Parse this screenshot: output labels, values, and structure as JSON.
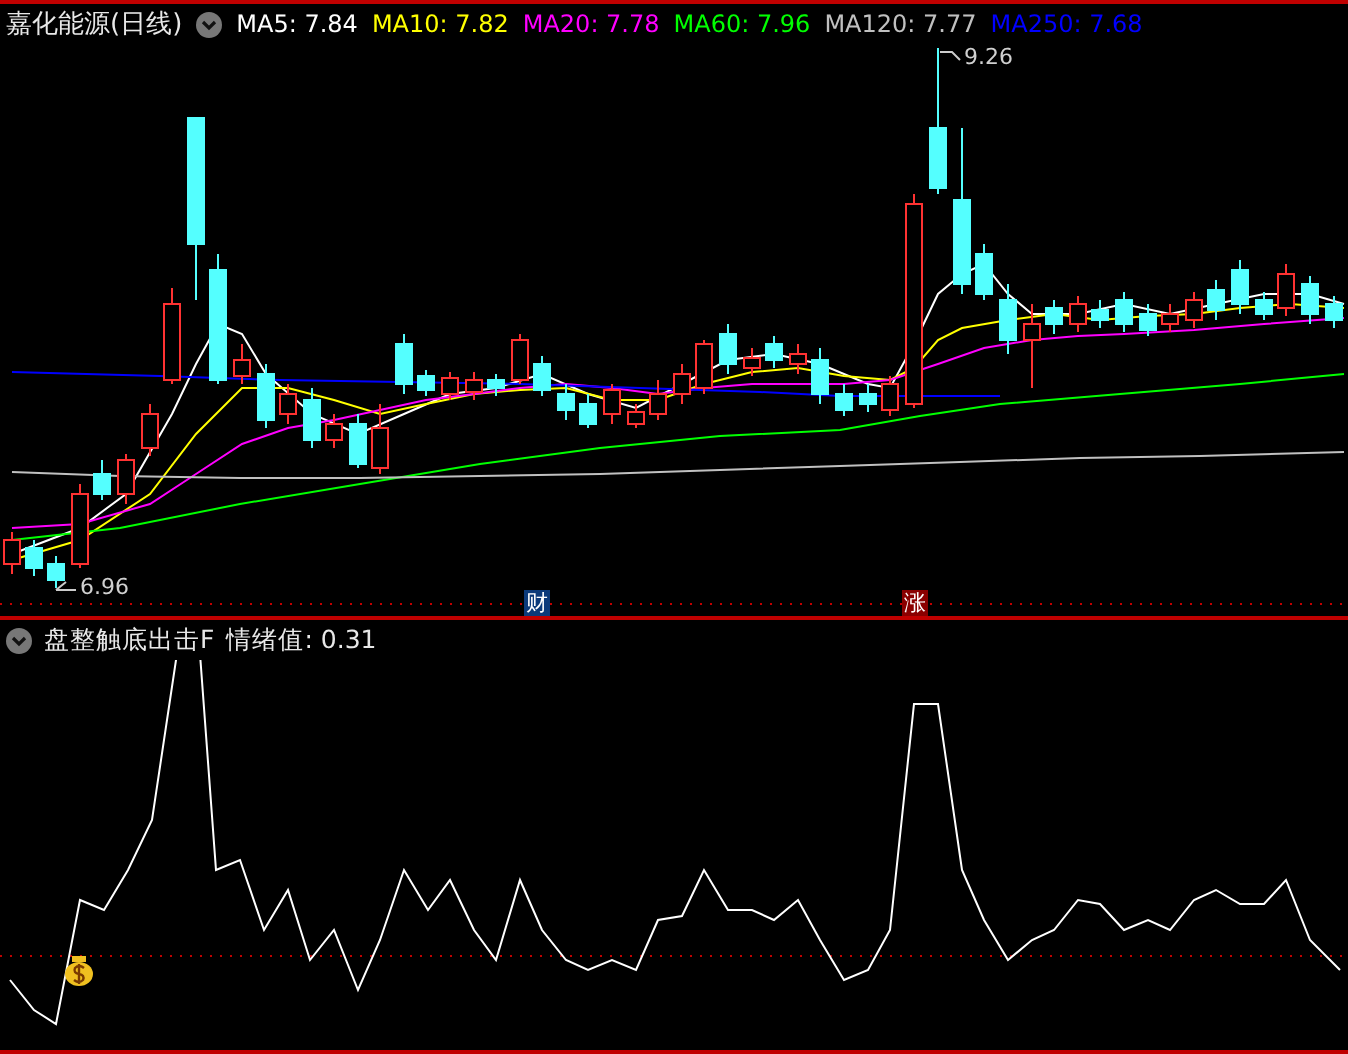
{
  "title": "嘉化能源(日线)",
  "moving_averages": [
    {
      "label": "MA5: 7.84",
      "color": "#ffffff"
    },
    {
      "label": "MA10: 7.82",
      "color": "#ffff00"
    },
    {
      "label": "MA20: 7.78",
      "color": "#ff00ff"
    },
    {
      "label": "MA60: 7.96",
      "color": "#00ff00"
    },
    {
      "label": "MA120: 7.77",
      "color": "#c0c0c0"
    },
    {
      "label": "MA250: 7.68",
      "color": "#0000ff"
    }
  ],
  "price_panel": {
    "high_label": "9.26",
    "low_label": "6.96",
    "markers": [
      {
        "text": "财",
        "kind": "finance"
      },
      {
        "text": "涨",
        "kind": "rise"
      }
    ]
  },
  "indicator": {
    "name": "盘整触底出击F",
    "reading": "情绪值: 0.31"
  }
}
